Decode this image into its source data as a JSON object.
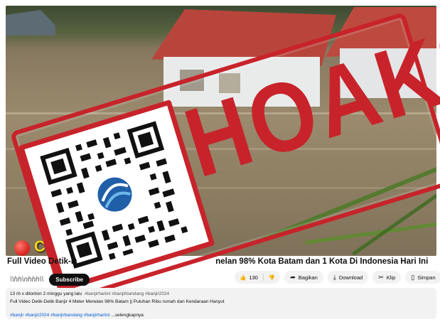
{
  "video": {
    "channel_overlay": "Cup",
    "stamp_text": "HOAKS",
    "colors": {
      "stamp": "#c8232a",
      "overlay_text": "#f1d21b",
      "flood": "#8f7f63"
    }
  },
  "title": "Full Video Detik-Detik Banjir 4 Meter Menelan 98% Kota Batam dan 1 Kota Di Indonesia Hari Ini",
  "title_visible_left": "Full Video Detik-D",
  "title_visible_right": "nelan 98% Kota Batam dan 1 Kota Di Indonesia Hari Ini",
  "channel": {
    "name": "\\\\hh\\nhhh\\\\",
    "subscribe_label": "Subscribe"
  },
  "actions": {
    "like_count": "130",
    "share_label": "Bagikan",
    "download_label": "Download",
    "clip_label": "Klip",
    "save_label": "Simpan",
    "more_label": "..."
  },
  "description": {
    "views_time": "13 rb x ditonton  2 minggu yang lalu",
    "tags_top": "#banjirhariini #banjirbandang #banjir2024",
    "text": "Full Video Detik-Detik Banjir 4 Meter Menelan 98% Batam || Puluhan Ribu rumah dan Kendaraan Hanyut",
    "tags_bottom": "#banjir #banjir2024 #banjirbandang #banjirhariini",
    "more": "...selengkapnya"
  }
}
